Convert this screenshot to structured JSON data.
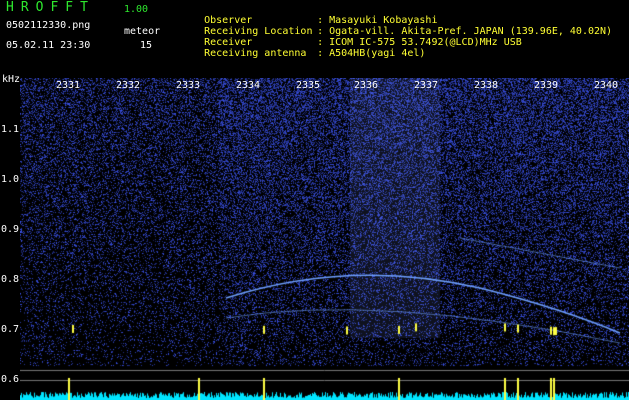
{
  "header": {
    "title": "HROFFT",
    "version": "1.00",
    "filename": "0502112330.png",
    "datetime": "05.02.11 23:30",
    "meteor_label": "meteor",
    "meteor_count": "15"
  },
  "info": [
    {
      "key": "Observer",
      "value": "Masayuki Kobayashi"
    },
    {
      "key": "Receiving Location",
      "value": "Ogata-vill. Akita-Pref. JAPAN (139.96E, 40.02N)"
    },
    {
      "key": "Receiver",
      "value": "ICOM IC-575 53.7492(@LCD)MHz USB"
    },
    {
      "key": "Receiving antenna",
      "value": "A504HB(yagi 4el)"
    }
  ],
  "axes": {
    "y_unit": "kHz",
    "y_ticks": [
      "1.1",
      "1.0",
      "0.9",
      "0.8",
      "0.7",
      "0.6"
    ],
    "x_ticks": [
      "2331",
      "2332",
      "2333",
      "2334",
      "2335",
      "2336",
      "2337",
      "2338",
      "2339",
      "2340"
    ]
  },
  "colors": {
    "background": "#000000",
    "noise": "#1a2aa8",
    "signal": "#6fa0ff",
    "meteor": "#ffff44",
    "level": "#00e5ff",
    "label_green": "#2ee82e",
    "label_yellow": "#ffff33"
  }
}
